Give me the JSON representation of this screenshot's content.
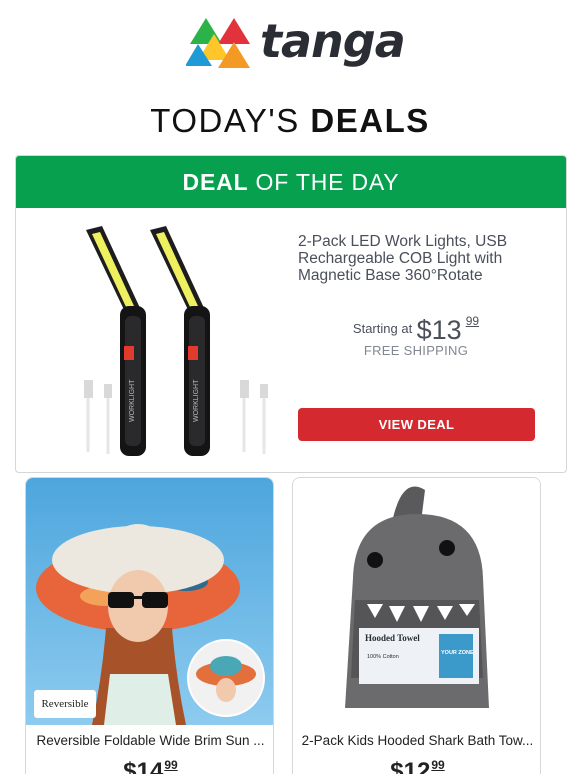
{
  "brand": {
    "name": "tanga"
  },
  "page_title": {
    "light": "TODAY'S ",
    "bold": "DEALS"
  },
  "deal_of_the_day": {
    "banner_bold": "DEAL",
    "banner_rest": " OF THE DAY",
    "title": "2-Pack LED Work Lights, USB Rechargeable COB Light with Magnetic Base 360°Rotate",
    "price_prefix": "Starting at",
    "price_dollars": "$13",
    "price_cents": "99",
    "shipping": "FREE SHIPPING",
    "button_label": "VIEW DEAL",
    "product_label": "WORKLIGHT"
  },
  "products": [
    {
      "title": "Reversible Foldable Wide Brim Sun ...",
      "price_dollars": "$14",
      "price_cents": "99",
      "tag": "Reversible"
    },
    {
      "title": "2-Pack Kids Hooded Shark Bath Tow...",
      "price_dollars": "$12",
      "price_cents": "99",
      "tag_line1": "Hooded Towel",
      "tag_line2": "100% Cotton",
      "tag_line3": "YOUR ZONE"
    }
  ],
  "colors": {
    "banner_green": "#06a04f",
    "button_red": "#d42a2f",
    "text_gray": "#4a4f5a"
  }
}
